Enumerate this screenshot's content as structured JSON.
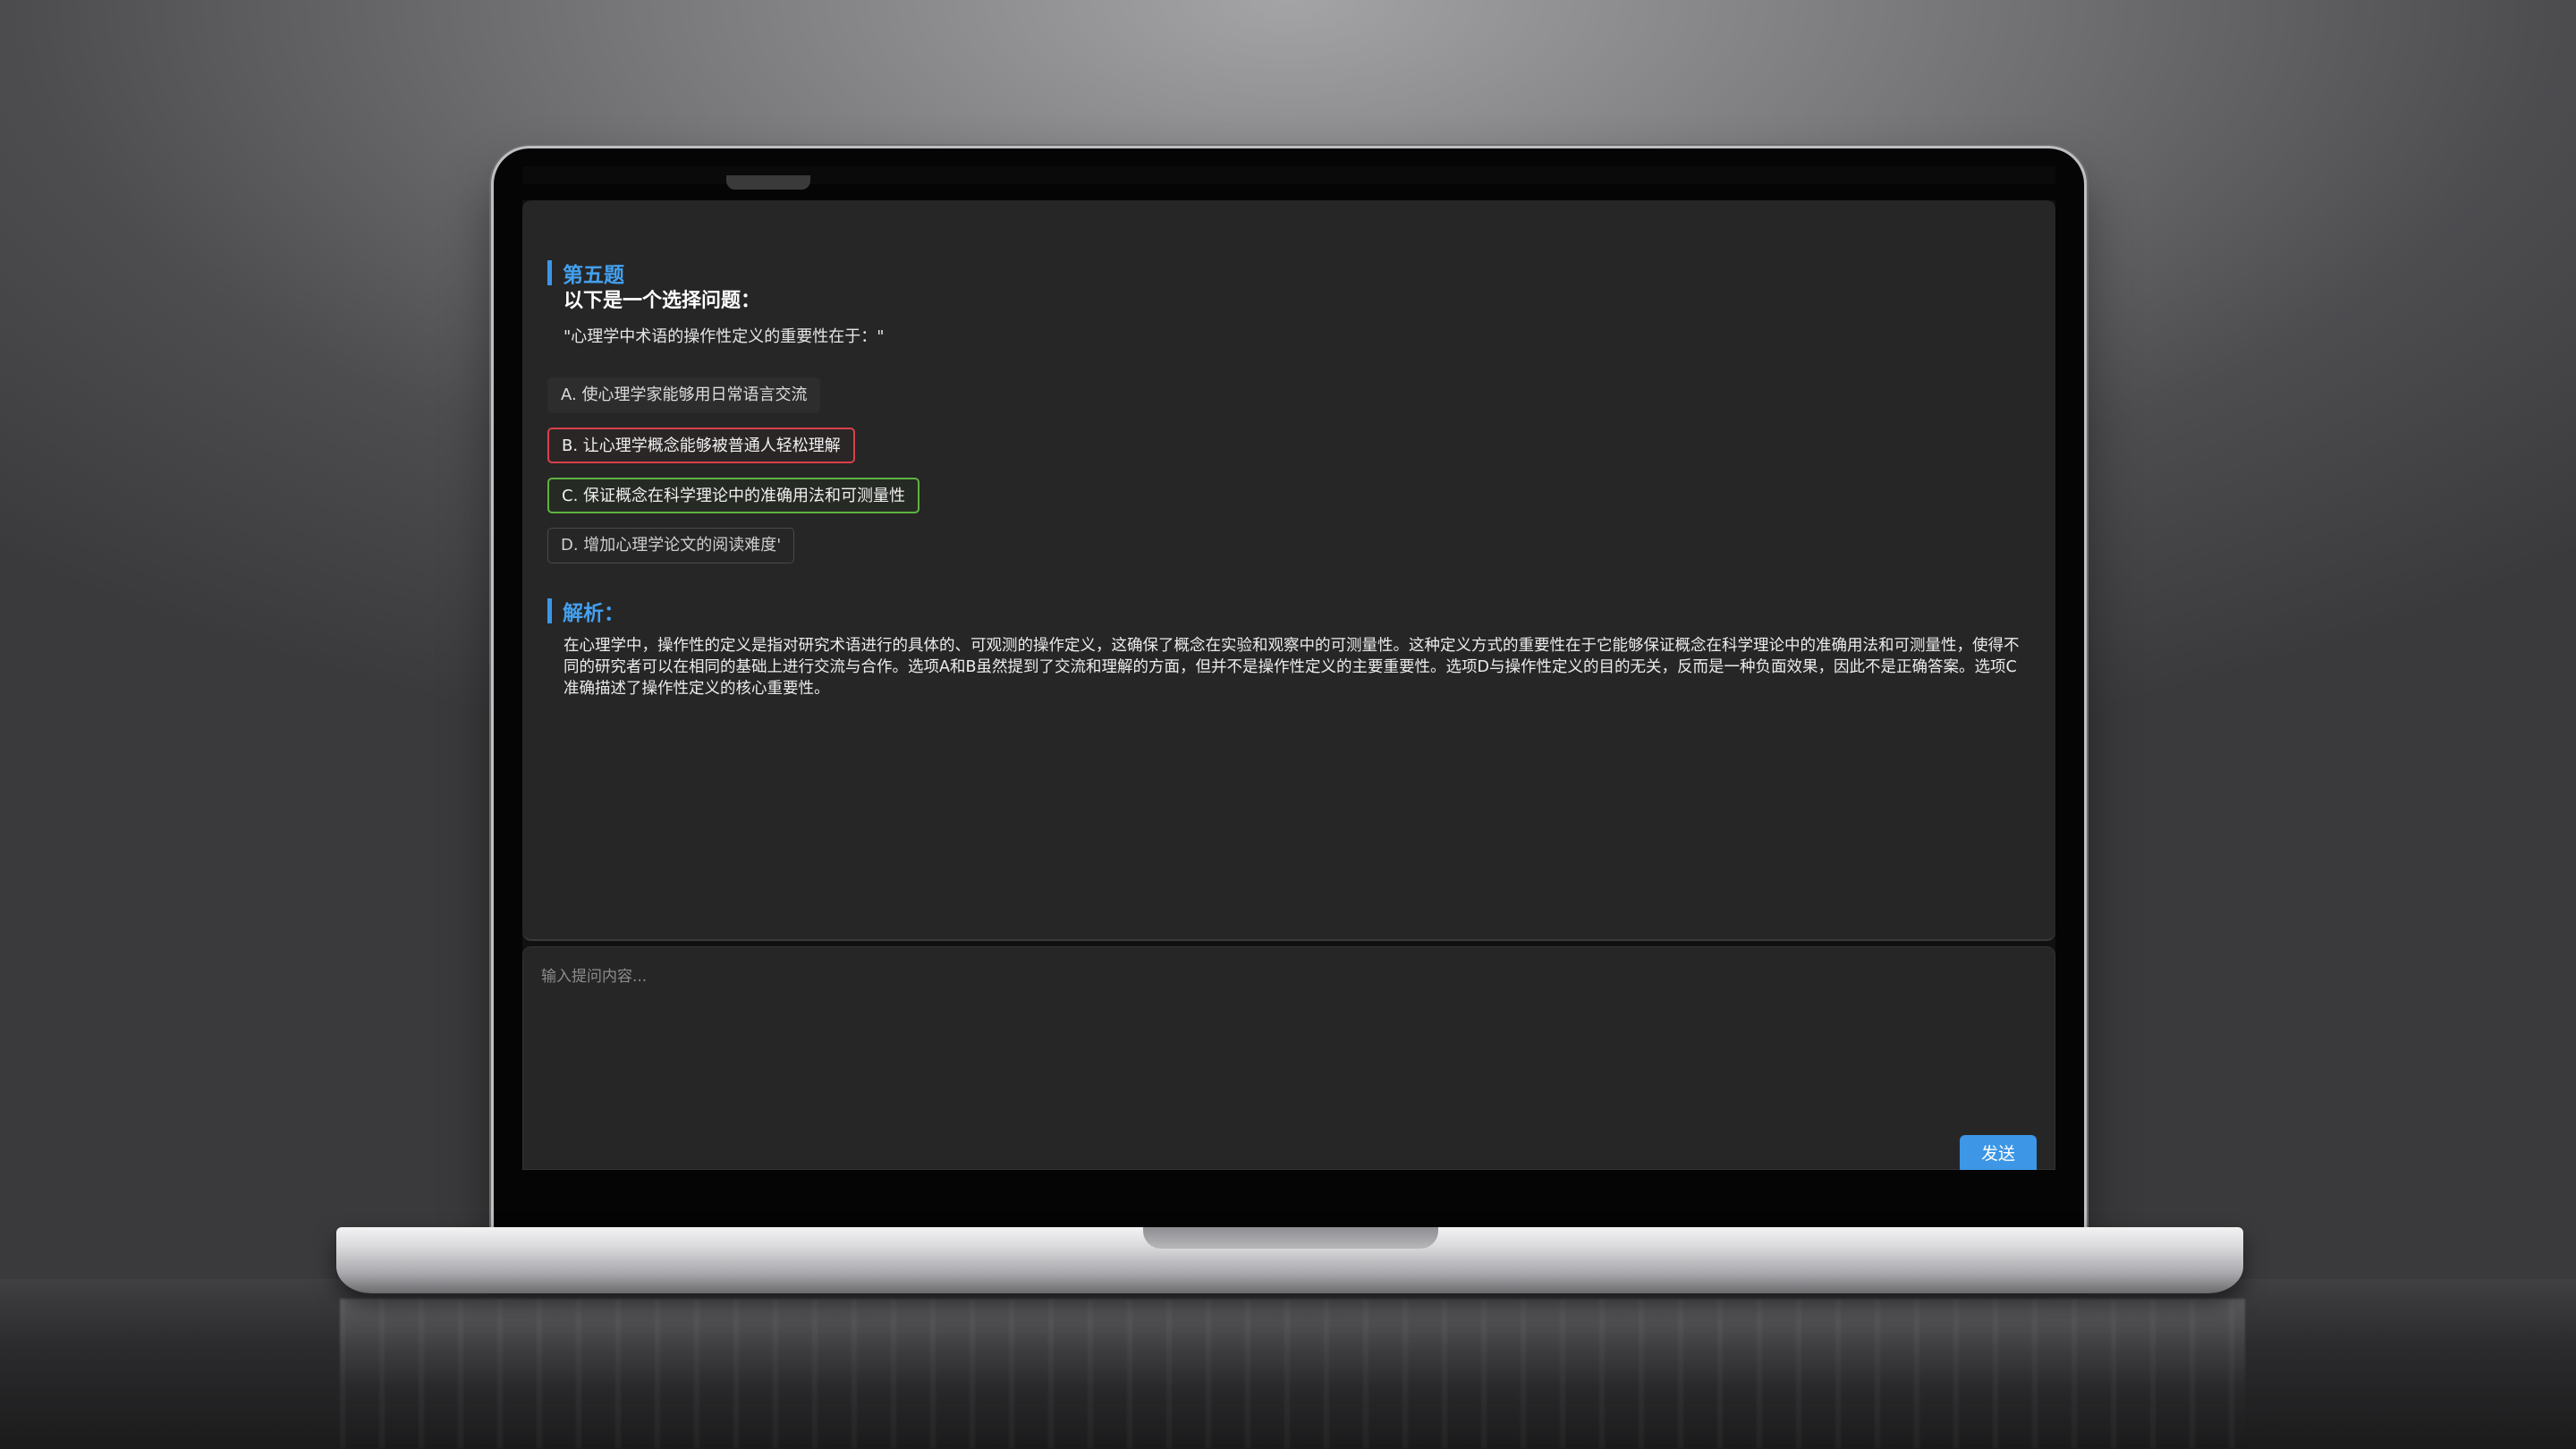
{
  "question": {
    "number_title": "第五题",
    "subtitle": "以下是一个选择问题：",
    "text": "\"心理学中术语的操作性定义的重要性在于：\"",
    "options": [
      {
        "label": "A. 使心理学家能够用日常语言交流",
        "state": "neutral"
      },
      {
        "label": "B. 让心理学概念能够被普通人轻松理解",
        "state": "wrong"
      },
      {
        "label": "C. 保证概念在科学理论中的准确用法和可测量性",
        "state": "correct"
      },
      {
        "label": "D. 增加心理学论文的阅读难度'",
        "state": "plain"
      }
    ]
  },
  "analysis": {
    "title": "解析：",
    "text": "在心理学中，操作性的定义是指对研究术语进行的具体的、可观测的操作定义，这确保了概念在实验和观察中的可测量性。这种定义方式的重要性在于它能够保证概念在科学理论中的准确用法和可测量性，使得不同的研究者可以在相同的基础上进行交流与合作。选项A和B虽然提到了交流和理解的方面，但并不是操作性定义的主要重要性。选项D与操作性定义的目的无关，反而是一种负面效果，因此不是正确答案。选项C准确描述了操作性定义的核心重要性。"
  },
  "input": {
    "placeholder": "输入提问内容...",
    "value": ""
  },
  "send_button": {
    "label": "发送"
  },
  "colors": {
    "accent": "#3d96e6",
    "wrong": "#d9414a",
    "correct": "#5fb340"
  }
}
